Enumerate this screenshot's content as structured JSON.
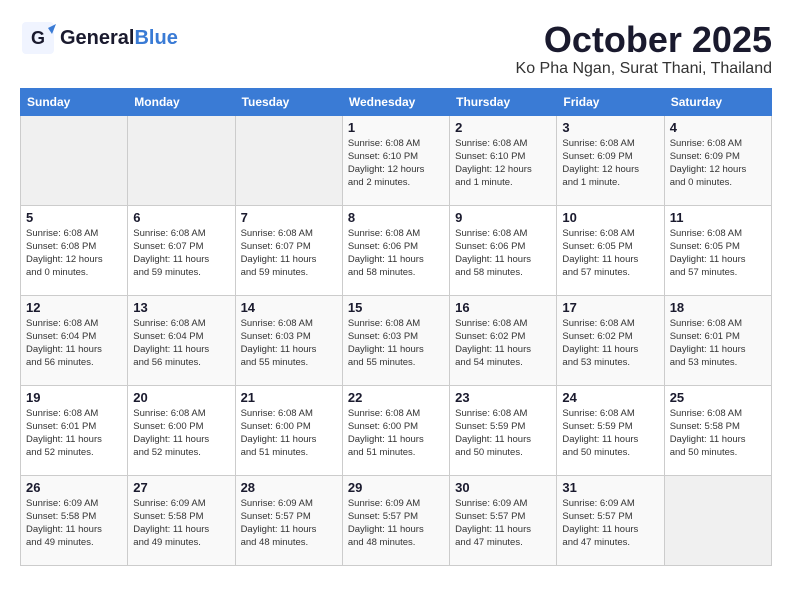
{
  "header": {
    "logo_general": "General",
    "logo_blue": "Blue",
    "month": "October 2025",
    "location": "Ko Pha Ngan, Surat Thani, Thailand"
  },
  "days_of_week": [
    "Sunday",
    "Monday",
    "Tuesday",
    "Wednesday",
    "Thursday",
    "Friday",
    "Saturday"
  ],
  "weeks": [
    [
      {
        "day": "",
        "info": ""
      },
      {
        "day": "",
        "info": ""
      },
      {
        "day": "",
        "info": ""
      },
      {
        "day": "1",
        "info": "Sunrise: 6:08 AM\nSunset: 6:10 PM\nDaylight: 12 hours\nand 2 minutes."
      },
      {
        "day": "2",
        "info": "Sunrise: 6:08 AM\nSunset: 6:10 PM\nDaylight: 12 hours\nand 1 minute."
      },
      {
        "day": "3",
        "info": "Sunrise: 6:08 AM\nSunset: 6:09 PM\nDaylight: 12 hours\nand 1 minute."
      },
      {
        "day": "4",
        "info": "Sunrise: 6:08 AM\nSunset: 6:09 PM\nDaylight: 12 hours\nand 0 minutes."
      }
    ],
    [
      {
        "day": "5",
        "info": "Sunrise: 6:08 AM\nSunset: 6:08 PM\nDaylight: 12 hours\nand 0 minutes."
      },
      {
        "day": "6",
        "info": "Sunrise: 6:08 AM\nSunset: 6:07 PM\nDaylight: 11 hours\nand 59 minutes."
      },
      {
        "day": "7",
        "info": "Sunrise: 6:08 AM\nSunset: 6:07 PM\nDaylight: 11 hours\nand 59 minutes."
      },
      {
        "day": "8",
        "info": "Sunrise: 6:08 AM\nSunset: 6:06 PM\nDaylight: 11 hours\nand 58 minutes."
      },
      {
        "day": "9",
        "info": "Sunrise: 6:08 AM\nSunset: 6:06 PM\nDaylight: 11 hours\nand 58 minutes."
      },
      {
        "day": "10",
        "info": "Sunrise: 6:08 AM\nSunset: 6:05 PM\nDaylight: 11 hours\nand 57 minutes."
      },
      {
        "day": "11",
        "info": "Sunrise: 6:08 AM\nSunset: 6:05 PM\nDaylight: 11 hours\nand 57 minutes."
      }
    ],
    [
      {
        "day": "12",
        "info": "Sunrise: 6:08 AM\nSunset: 6:04 PM\nDaylight: 11 hours\nand 56 minutes."
      },
      {
        "day": "13",
        "info": "Sunrise: 6:08 AM\nSunset: 6:04 PM\nDaylight: 11 hours\nand 56 minutes."
      },
      {
        "day": "14",
        "info": "Sunrise: 6:08 AM\nSunset: 6:03 PM\nDaylight: 11 hours\nand 55 minutes."
      },
      {
        "day": "15",
        "info": "Sunrise: 6:08 AM\nSunset: 6:03 PM\nDaylight: 11 hours\nand 55 minutes."
      },
      {
        "day": "16",
        "info": "Sunrise: 6:08 AM\nSunset: 6:02 PM\nDaylight: 11 hours\nand 54 minutes."
      },
      {
        "day": "17",
        "info": "Sunrise: 6:08 AM\nSunset: 6:02 PM\nDaylight: 11 hours\nand 53 minutes."
      },
      {
        "day": "18",
        "info": "Sunrise: 6:08 AM\nSunset: 6:01 PM\nDaylight: 11 hours\nand 53 minutes."
      }
    ],
    [
      {
        "day": "19",
        "info": "Sunrise: 6:08 AM\nSunset: 6:01 PM\nDaylight: 11 hours\nand 52 minutes."
      },
      {
        "day": "20",
        "info": "Sunrise: 6:08 AM\nSunset: 6:00 PM\nDaylight: 11 hours\nand 52 minutes."
      },
      {
        "day": "21",
        "info": "Sunrise: 6:08 AM\nSunset: 6:00 PM\nDaylight: 11 hours\nand 51 minutes."
      },
      {
        "day": "22",
        "info": "Sunrise: 6:08 AM\nSunset: 6:00 PM\nDaylight: 11 hours\nand 51 minutes."
      },
      {
        "day": "23",
        "info": "Sunrise: 6:08 AM\nSunset: 5:59 PM\nDaylight: 11 hours\nand 50 minutes."
      },
      {
        "day": "24",
        "info": "Sunrise: 6:08 AM\nSunset: 5:59 PM\nDaylight: 11 hours\nand 50 minutes."
      },
      {
        "day": "25",
        "info": "Sunrise: 6:08 AM\nSunset: 5:58 PM\nDaylight: 11 hours\nand 50 minutes."
      }
    ],
    [
      {
        "day": "26",
        "info": "Sunrise: 6:09 AM\nSunset: 5:58 PM\nDaylight: 11 hours\nand 49 minutes."
      },
      {
        "day": "27",
        "info": "Sunrise: 6:09 AM\nSunset: 5:58 PM\nDaylight: 11 hours\nand 49 minutes."
      },
      {
        "day": "28",
        "info": "Sunrise: 6:09 AM\nSunset: 5:57 PM\nDaylight: 11 hours\nand 48 minutes."
      },
      {
        "day": "29",
        "info": "Sunrise: 6:09 AM\nSunset: 5:57 PM\nDaylight: 11 hours\nand 48 minutes."
      },
      {
        "day": "30",
        "info": "Sunrise: 6:09 AM\nSunset: 5:57 PM\nDaylight: 11 hours\nand 47 minutes."
      },
      {
        "day": "31",
        "info": "Sunrise: 6:09 AM\nSunset: 5:57 PM\nDaylight: 11 hours\nand 47 minutes."
      },
      {
        "day": "",
        "info": ""
      }
    ]
  ]
}
